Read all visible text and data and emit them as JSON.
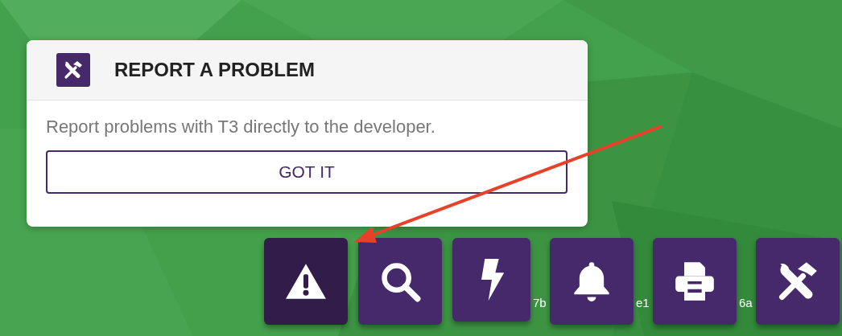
{
  "popup": {
    "title": "REPORT A PROBLEM",
    "message": "Report problems with T3 directly to the developer.",
    "button": "GOT IT"
  },
  "toolbar": [
    {
      "kind": "warning",
      "selected": true
    },
    {
      "kind": "search",
      "selected": false
    },
    {
      "kind": "bolt",
      "selected": false,
      "trailing_text": "7b"
    },
    {
      "kind": "bell",
      "selected": false,
      "trailing_text": "e1"
    },
    {
      "kind": "printer",
      "selected": false,
      "trailing_text": "6a"
    },
    {
      "kind": "tools",
      "selected": false
    }
  ]
}
